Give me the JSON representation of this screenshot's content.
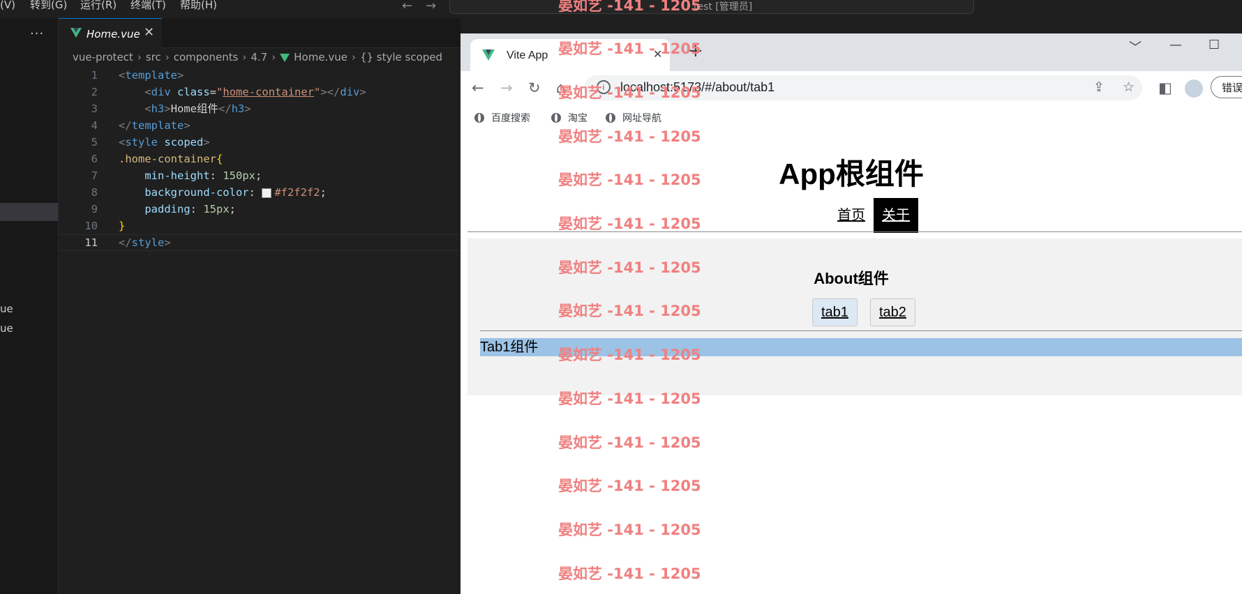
{
  "menubar": {
    "items": [
      "(V)",
      "转到(G)",
      "运行(R)",
      "终端(T)",
      "帮助(H)"
    ],
    "command_center": "test [管理员]"
  },
  "explorer": {
    "more": "···",
    "file_1": "ue",
    "file_2": "ue"
  },
  "editor": {
    "tab_name": "Home.vue",
    "tab_close": "✕",
    "breadcrumb": [
      "vue-protect",
      "src",
      "components",
      "4.7",
      "Home.vue",
      "{} style scoped"
    ],
    "line_numbers": [
      "1",
      "2",
      "3",
      "4",
      "5",
      "6",
      "7",
      "8",
      "9",
      "10",
      "11"
    ],
    "code": {
      "l1_tag": "template",
      "l2_tag": "div",
      "l2_attr": "class",
      "l2_val": "home-container",
      "l3_tag": "h3",
      "l3_text": "Home组件",
      "l4_tag": "template",
      "l5_tag": "style",
      "l5_attr": "scoped",
      "l6_sel": ".home-container",
      "l7_prop": "min-height",
      "l7_val": "150px",
      "l8_prop": "background-color",
      "l8_val": "#f2f2f2",
      "l9_prop": "padding",
      "l9_val": "15px",
      "l11_tag": "style"
    }
  },
  "browser": {
    "tab_title": "Vite App",
    "url": "localhost:5173/#/about/tab1",
    "profile_button": "错误",
    "bookmarks": [
      "百度搜索",
      "淘宝",
      "网址导航"
    ]
  },
  "page": {
    "app_title": "App根组件",
    "nav": [
      "首页",
      "关于"
    ],
    "about_title": "About组件",
    "tabs": [
      "tab1",
      "tab2"
    ],
    "tab1_content": "Tab1组件"
  },
  "watermark": "晏如艺 -141 - 1205",
  "colors": {
    "vscode_bg": "#1e1e1e",
    "vue_green": "#41b883",
    "tab_highlight": "#9cc2e5",
    "about_bg": "#f2f2f2",
    "watermark": "#f08080"
  }
}
